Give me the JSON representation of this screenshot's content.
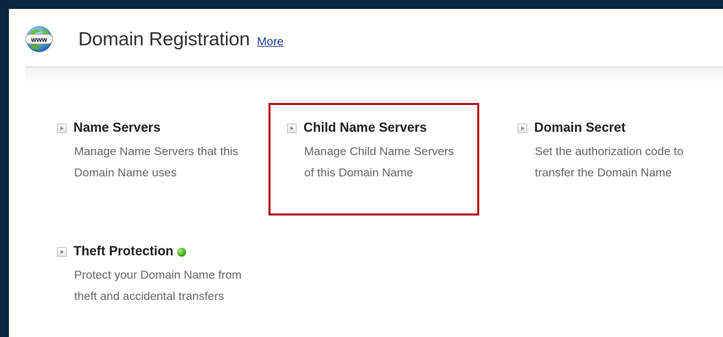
{
  "header": {
    "title": "Domain Registration",
    "more_link": "More",
    "logo_text": "www"
  },
  "options": [
    {
      "title": "Name Servers",
      "description": "Manage Name Servers that this Domain Name uses"
    },
    {
      "title": "Child Name Servers",
      "description": "Manage Child Name Servers of this Domain Name"
    },
    {
      "title": "Domain Secret",
      "description": "Set the authorization code to transfer the Domain Name"
    },
    {
      "title": "Theft Protection",
      "description": "Protect your Domain Name from theft and accidental transfers",
      "status": "enabled"
    }
  ],
  "colors": {
    "background": "#0a2540",
    "highlight": "#b3141d",
    "link": "#1a3e9a",
    "status_ok": "#3aa81e"
  },
  "icons": {
    "logo": "www-globe-icon",
    "option_arrow": "arrow-right-icon",
    "status": "green-status-dot-icon"
  }
}
